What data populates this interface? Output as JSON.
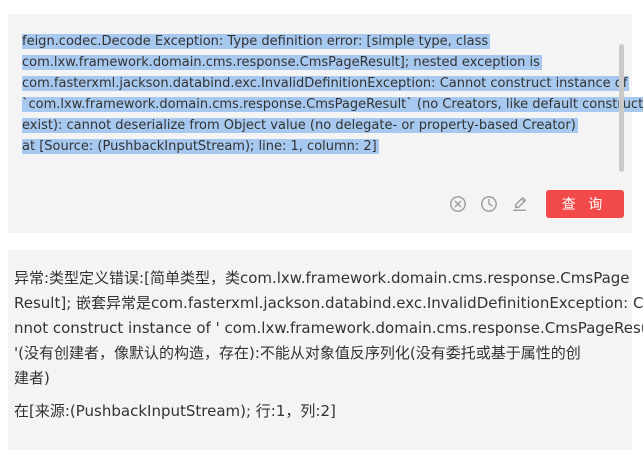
{
  "input": {
    "lines": [
      "feign.codec.Decode Exception: Type definition error: [simple type, class",
      "com.lxw.framework.domain.cms.response.CmsPageResult];   nested exception is",
      "com.fasterxml.jackson.databind.exc.InvalidDefinitionException: Cannot construct instance of",
      "`com.lxw.framework.domain.cms.response.CmsPageResult` (no Creators, like default construct,",
      "exist): cannot deserialize from Object value (no delegate- or property-based Creator)",
      "at [Source: (PushbackInputStream);   line: 1, column: 2]"
    ]
  },
  "toolbar": {
    "clear_icon": "close-circle-icon",
    "history_icon": "clock-icon",
    "edit_icon": "pen-icon",
    "query_label": "查 询"
  },
  "result": {
    "lines": [
      "异常:类型定义错误:[简单类型，类com.lxw.framework.domain.cms.response.CmsPage",
      "Result]; 嵌套异常是com.fasterxml.jackson.databind.exc.InvalidDefinitionException: Ca",
      "nnot construct instance of ' com.lxw.framework.domain.cms.response.CmsPageResult",
      "'(没有创建者，像默认的构造，存在):不能从对象值反序列化(没有委托或基于属性的创",
      "建者)"
    ],
    "line_last": "在[来源:(PushbackInputStream); 行:1，列:2]"
  },
  "colors": {
    "selection": "#a8c9ef",
    "panel_bg": "#f4f4f4",
    "query_button": "#f24a4a",
    "icon": "#9a9a9a"
  }
}
